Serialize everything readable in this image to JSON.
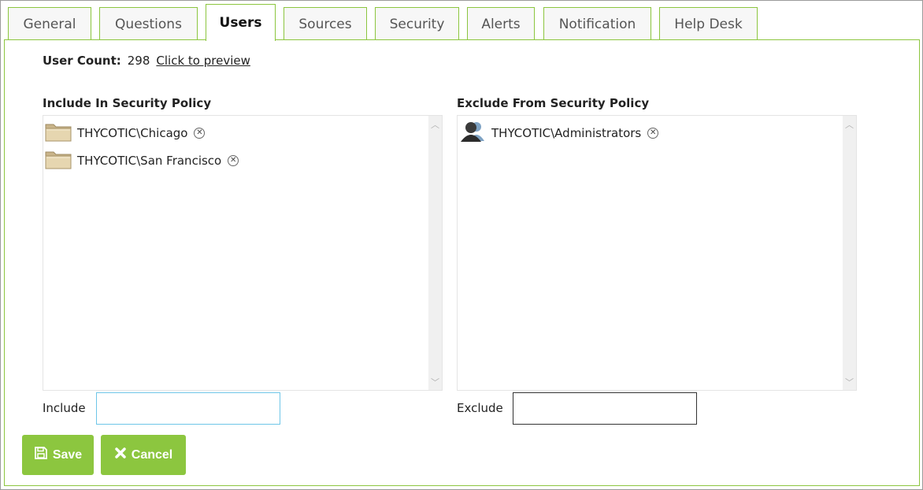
{
  "tabs": [
    {
      "label": "General"
    },
    {
      "label": "Questions"
    },
    {
      "label": "Users"
    },
    {
      "label": "Sources"
    },
    {
      "label": "Security"
    },
    {
      "label": "Alerts"
    },
    {
      "label": "Notification"
    },
    {
      "label": "Help Desk"
    }
  ],
  "active_tab": "Users",
  "user_count": {
    "label": "User Count:",
    "value": "298",
    "link": "Click to preview"
  },
  "include": {
    "title": "Include In Security Policy",
    "items": [
      {
        "name": "THYCOTIC\\Chicago",
        "icon": "folder-icon"
      },
      {
        "name": "THYCOTIC\\San Francisco",
        "icon": "folder-icon"
      }
    ],
    "field_label": "Include",
    "field_value": ""
  },
  "exclude": {
    "title": "Exclude From Security Policy",
    "items": [
      {
        "name": "THYCOTIC\\Administrators",
        "icon": "user-group-icon"
      }
    ],
    "field_label": "Exclude",
    "field_value": ""
  },
  "buttons": {
    "save": "Save",
    "cancel": "Cancel"
  },
  "colors": {
    "accent": "#8cc63f",
    "focus_border": "#6ec6e8"
  }
}
